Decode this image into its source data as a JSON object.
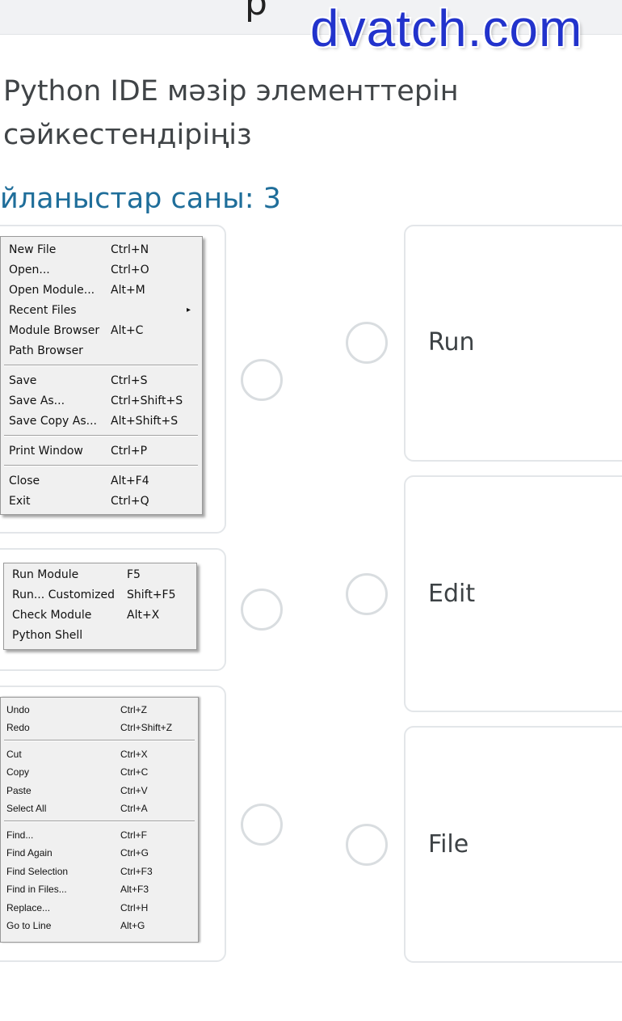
{
  "watermark": "dvatch.com",
  "question": "Python IDE мәзір элементтерін сәйкестендіріңіз",
  "pairs_count": "йланыстар саны: 3",
  "file_menu": {
    "items": [
      {
        "label": "New File",
        "shortcut": "Ctrl+N"
      },
      {
        "label": "Open...",
        "shortcut": "Ctrl+O"
      },
      {
        "label": "Open Module...",
        "shortcut": "Alt+M"
      },
      {
        "label": "Recent Files",
        "shortcut": ""
      },
      {
        "label": "Module Browser",
        "shortcut": "Alt+C"
      },
      {
        "label": "Path Browser",
        "shortcut": ""
      },
      {
        "label": "Save",
        "shortcut": "Ctrl+S"
      },
      {
        "label": "Save As...",
        "shortcut": "Ctrl+Shift+S"
      },
      {
        "label": "Save Copy As...",
        "shortcut": "Alt+Shift+S"
      },
      {
        "label": "Print Window",
        "shortcut": "Ctrl+P"
      },
      {
        "label": "Close",
        "shortcut": "Alt+F4"
      },
      {
        "label": "Exit",
        "shortcut": "Ctrl+Q"
      }
    ],
    "submenu_arrow": "▸"
  },
  "run_menu": {
    "items": [
      {
        "label": "Run Module",
        "shortcut": "F5"
      },
      {
        "label": "Run... Customized",
        "shortcut": "Shift+F5"
      },
      {
        "label": "Check Module",
        "shortcut": "Alt+X"
      },
      {
        "label": "Python Shell",
        "shortcut": ""
      }
    ]
  },
  "edit_menu": {
    "items": [
      {
        "label": "Undo",
        "shortcut": "Ctrl+Z"
      },
      {
        "label": "Redo",
        "shortcut": "Ctrl+Shift+Z"
      },
      {
        "label": "Cut",
        "shortcut": "Ctrl+X"
      },
      {
        "label": "Copy",
        "shortcut": "Ctrl+C"
      },
      {
        "label": "Paste",
        "shortcut": "Ctrl+V"
      },
      {
        "label": "Select All",
        "shortcut": "Ctrl+A"
      },
      {
        "label": "Find...",
        "shortcut": "Ctrl+F"
      },
      {
        "label": "Find Again",
        "shortcut": "Ctrl+G"
      },
      {
        "label": "Find Selection",
        "shortcut": "Ctrl+F3"
      },
      {
        "label": "Find in Files...",
        "shortcut": "Alt+F3"
      },
      {
        "label": "Replace...",
        "shortcut": "Ctrl+H"
      },
      {
        "label": "Go to Line",
        "shortcut": "Alt+G"
      }
    ]
  },
  "options": [
    {
      "label": "Run"
    },
    {
      "label": "Edit"
    },
    {
      "label": "File"
    }
  ],
  "colors": {
    "accent_blue": "#1f6e9a",
    "watermark_blue": "#2233cc",
    "card_border": "#e3e6e9"
  }
}
